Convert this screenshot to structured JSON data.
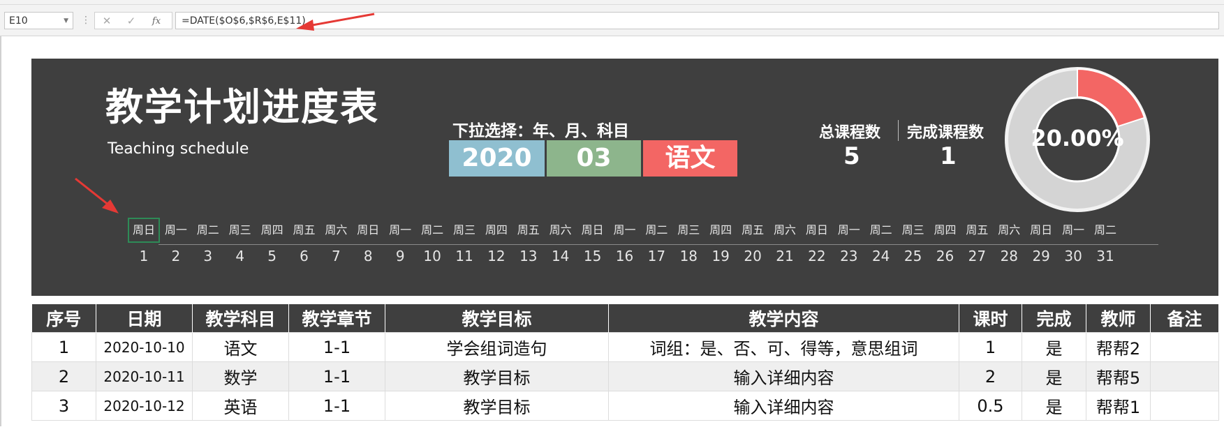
{
  "formula_bar": {
    "name_box": "E10",
    "cancel_icon": "✕",
    "enter_icon": "✓",
    "fx_label": "fx",
    "formula": "=DATE($O$6,$R$6,E$11)"
  },
  "dashboard": {
    "title": "教学计划进度表",
    "subtitle": "Teaching schedule",
    "dropdown_label": "下拉选择：年、月、科目",
    "year": "2020",
    "month": "03",
    "subject": "语文",
    "total_label": "总课程数",
    "total_value": "5",
    "done_label": "完成课程数",
    "done_value": "1",
    "progress_text": "20.00%",
    "progress_fraction": 0.2
  },
  "calendar": {
    "weekdays": [
      "周日",
      "周一",
      "周二",
      "周三",
      "周四",
      "周五",
      "周六",
      "周日",
      "周一",
      "周二",
      "周三",
      "周四",
      "周五",
      "周六",
      "周日",
      "周一",
      "周二",
      "周三",
      "周四",
      "周五",
      "周六",
      "周日",
      "周一",
      "周二",
      "周三",
      "周四",
      "周五",
      "周六",
      "周日",
      "周一",
      "周二"
    ],
    "days": [
      "1",
      "2",
      "3",
      "4",
      "5",
      "6",
      "7",
      "8",
      "9",
      "10",
      "11",
      "12",
      "13",
      "14",
      "15",
      "16",
      "17",
      "18",
      "19",
      "20",
      "21",
      "22",
      "23",
      "24",
      "25",
      "26",
      "27",
      "28",
      "29",
      "30",
      "31"
    ]
  },
  "table": {
    "headers": [
      "序号",
      "日期",
      "教学科目",
      "教学章节",
      "教学目标",
      "教学内容",
      "课时",
      "完成",
      "教师",
      "备注"
    ],
    "rows": [
      [
        "1",
        "2020-10-10",
        "语文",
        "1-1",
        "学会组词造句",
        "词组：是、否、可、得等，意思组词",
        "1",
        "是",
        "帮帮2",
        ""
      ],
      [
        "2",
        "2020-10-11",
        "数学",
        "1-1",
        "教学目标",
        "输入详细内容",
        "2",
        "是",
        "帮帮5",
        ""
      ],
      [
        "3",
        "2020-10-12",
        "英语",
        "1-1",
        "教学目标",
        "输入详细内容",
        "0.5",
        "是",
        "帮帮1",
        ""
      ]
    ]
  },
  "colors": {
    "dashboard_bg": "#3f3f3f",
    "year_bg": "#8fbfd0",
    "month_bg": "#8db58c",
    "subject_bg": "#f36664",
    "donut_fill": "#f36664",
    "donut_track": "#d4d4d4",
    "arrow": "#e53935"
  }
}
